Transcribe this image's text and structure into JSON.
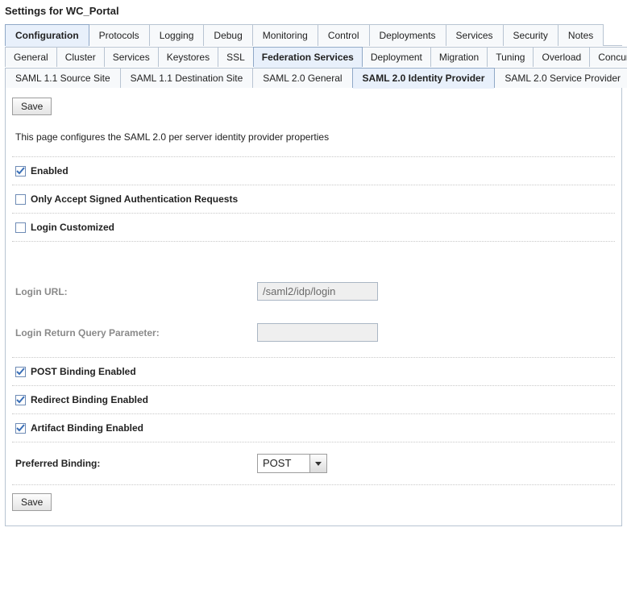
{
  "page_title": "Settings for WC_Portal",
  "tabs_level1": [
    "Configuration",
    "Protocols",
    "Logging",
    "Debug",
    "Monitoring",
    "Control",
    "Deployments",
    "Services",
    "Security",
    "Notes"
  ],
  "tabs_level1_active": 0,
  "tabs_level2": [
    "General",
    "Cluster",
    "Services",
    "Keystores",
    "SSL",
    "Federation Services",
    "Deployment",
    "Migration",
    "Tuning",
    "Overload",
    "Concurre"
  ],
  "tabs_level2_active": 5,
  "tabs_level3": [
    "SAML 1.1 Source Site",
    "SAML 1.1 Destination Site",
    "SAML 2.0 General",
    "SAML 2.0 Identity Provider",
    "SAML 2.0 Service Provider"
  ],
  "tabs_level3_active": 3,
  "buttons": {
    "save": "Save"
  },
  "description": "This page configures the SAML 2.0 per server identity provider properties",
  "fields": {
    "enabled": {
      "label": "Enabled",
      "checked": true
    },
    "only_signed": {
      "label": "Only Accept Signed Authentication Requests",
      "checked": false
    },
    "login_customized": {
      "label": "Login Customized",
      "checked": false
    },
    "login_url": {
      "label": "Login URL:",
      "value": "/saml2/idp/login"
    },
    "login_return_qp": {
      "label": "Login Return Query Parameter:",
      "value": ""
    },
    "post_binding": {
      "label": "POST Binding Enabled",
      "checked": true
    },
    "redirect_binding": {
      "label": "Redirect Binding Enabled",
      "checked": true
    },
    "artifact_binding": {
      "label": "Artifact Binding Enabled",
      "checked": true
    },
    "preferred_binding": {
      "label": "Preferred Binding:",
      "value": "POST"
    }
  }
}
